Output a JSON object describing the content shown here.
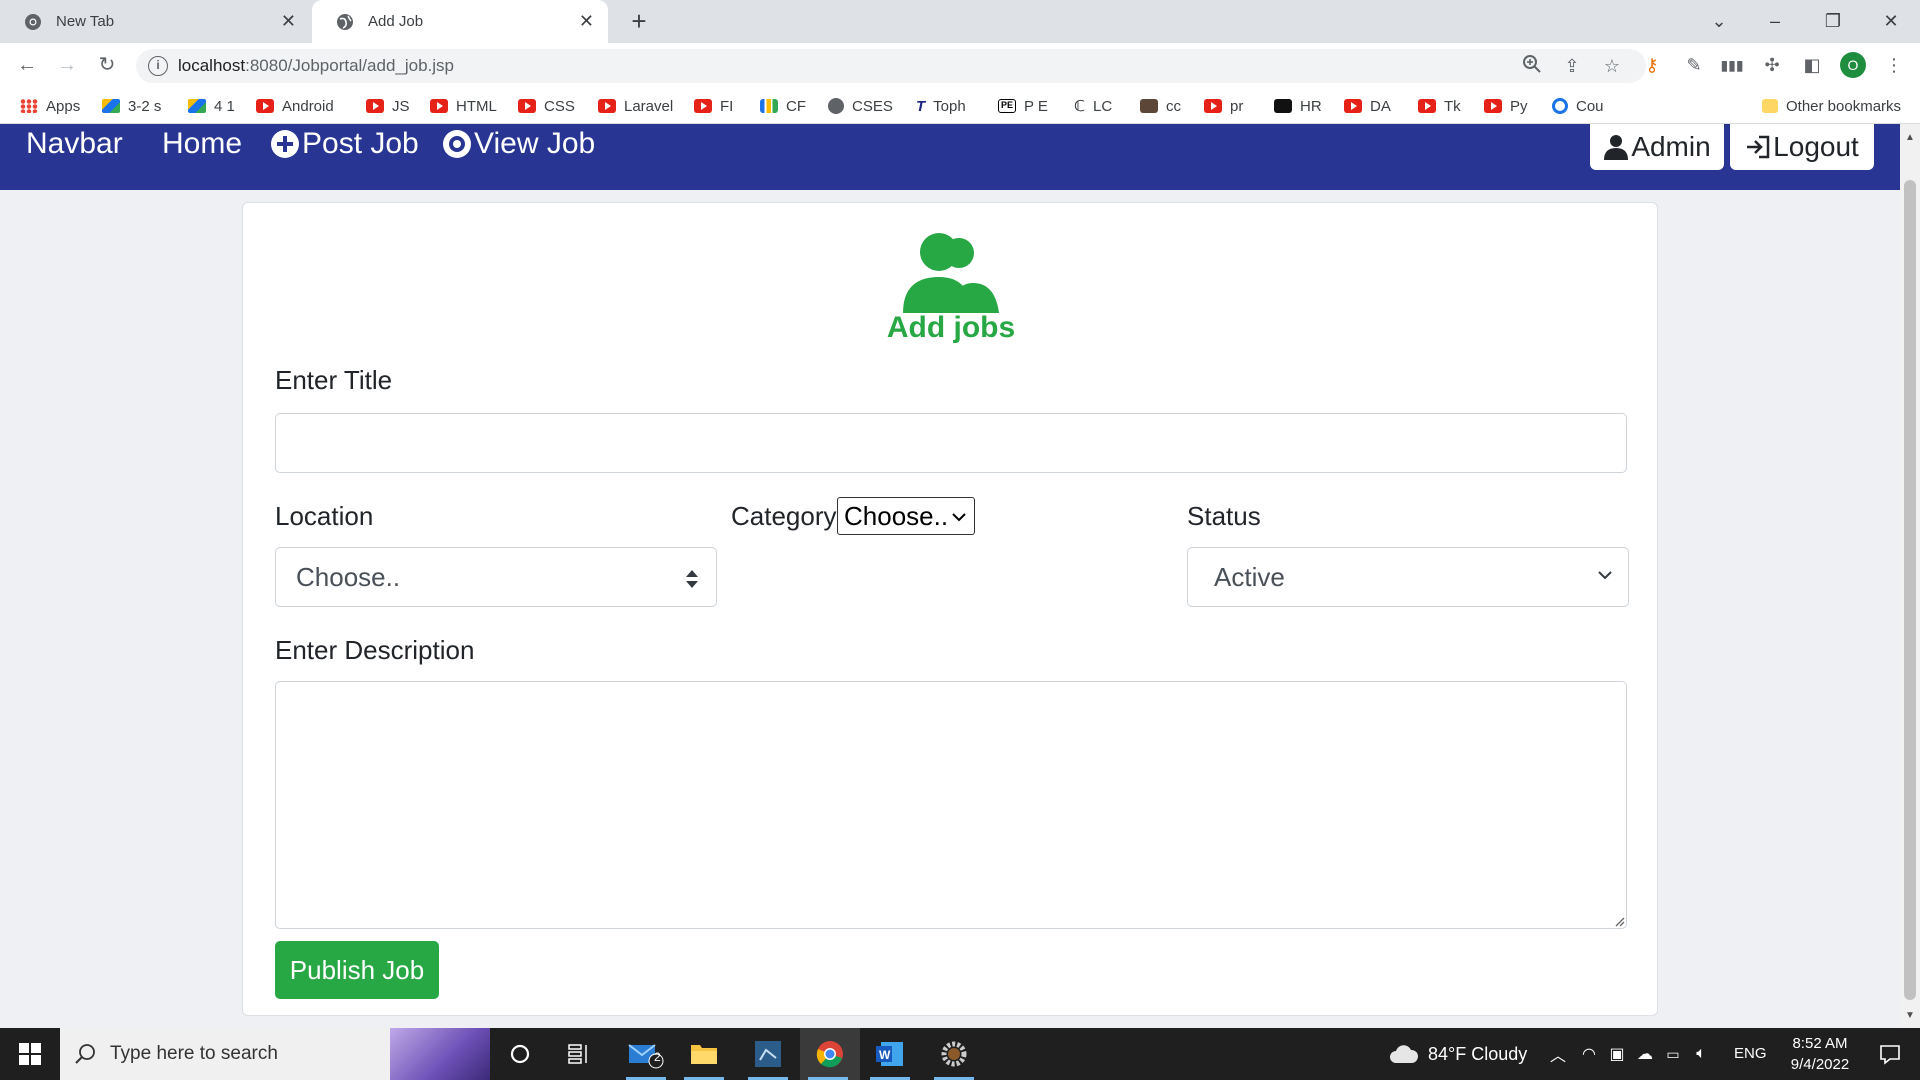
{
  "browser": {
    "tabs": [
      {
        "label": "New Tab",
        "active": false
      },
      {
        "label": "Add Job",
        "active": true
      }
    ],
    "url_host": "localhost",
    "url_rest": ":8080/Jobportal/add_job.jsp",
    "bookmarks": [
      "Apps",
      "3-2 s",
      "4 1",
      "Android",
      "JS",
      "HTML",
      "CSS",
      "Laravel",
      "FI",
      "CF",
      "CSES",
      "Toph",
      "P E",
      "LC",
      "cc",
      "pr",
      "HR",
      "DA",
      "Tk",
      "Py",
      "Cou",
      "Other bookmarks"
    ],
    "profile_initial": "O"
  },
  "navbar": {
    "brand": "Navbar",
    "home": "Home",
    "post_job": "Post Job",
    "view_job": "View Job",
    "admin": "Admin",
    "logout": "Logout",
    "color": "#283593"
  },
  "form": {
    "title": "Add jobs",
    "title_label": "Enter Title",
    "title_value": "",
    "location_label": "Location",
    "location_selected": "Choose..",
    "category_label": "Category",
    "category_selected": "Choose..",
    "status_label": "Status",
    "status_selected": "Active",
    "description_label": "Enter Description",
    "description_value": "",
    "publish_label": "Publish Job",
    "accent_color": "#28a745"
  },
  "taskbar": {
    "search_placeholder": "Type here to search",
    "mail_badge": "2",
    "weather": "84°F  Cloudy",
    "language": "ENG",
    "time": "8:52 AM",
    "date": "9/4/2022"
  }
}
